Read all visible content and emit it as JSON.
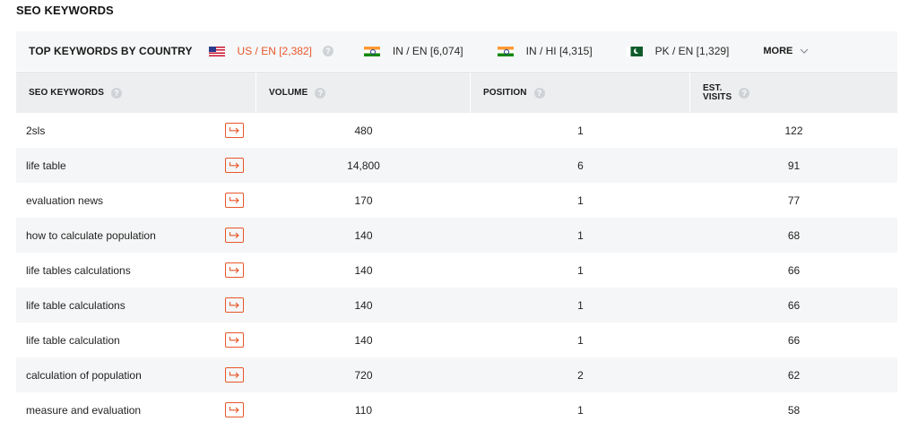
{
  "section": {
    "title": "SEO KEYWORDS"
  },
  "country_bar": {
    "label": "TOP KEYWORDS BY COUNTRY",
    "countries": [
      {
        "flag": "us-flag",
        "label": "US / EN [2,382]",
        "active": true
      },
      {
        "flag": "in-flag",
        "label": "IN / EN [6,074]",
        "active": false
      },
      {
        "flag": "in-flag",
        "label": "IN / HI [4,315]",
        "active": false
      },
      {
        "flag": "pk-flag",
        "label": "PK / EN [1,329]",
        "active": false
      }
    ],
    "more_label": "MORE"
  },
  "table": {
    "headers": {
      "keyword": "SEO KEYWORDS",
      "volume": "VOLUME",
      "position": "POSITION",
      "visits_line1": "EST.",
      "visits_line2": "VISITS"
    },
    "rows": [
      {
        "keyword": "2sls",
        "volume": "480",
        "position": "1",
        "visits": "122"
      },
      {
        "keyword": "life table",
        "volume": "14,800",
        "position": "6",
        "visits": "91"
      },
      {
        "keyword": "evaluation news",
        "volume": "170",
        "position": "1",
        "visits": "77"
      },
      {
        "keyword": "how to calculate population",
        "volume": "140",
        "position": "1",
        "visits": "68"
      },
      {
        "keyword": "life tables calculations",
        "volume": "140",
        "position": "1",
        "visits": "66"
      },
      {
        "keyword": "life table calculations",
        "volume": "140",
        "position": "1",
        "visits": "66"
      },
      {
        "keyword": "life table calculation",
        "volume": "140",
        "position": "1",
        "visits": "66"
      },
      {
        "keyword": "calculation of population",
        "volume": "720",
        "position": "2",
        "visits": "62"
      },
      {
        "keyword": "measure and evaluation",
        "volume": "110",
        "position": "1",
        "visits": "58"
      }
    ]
  },
  "colors": {
    "accent": "#e8572a",
    "header_bg": "#edeef0",
    "stripe": "#f5f6f7"
  },
  "help_glyph": "?"
}
